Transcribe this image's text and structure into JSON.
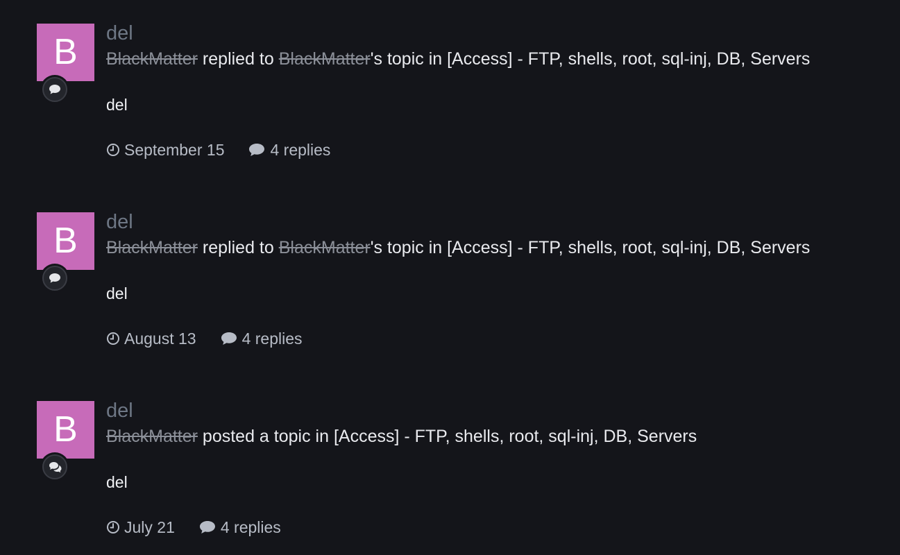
{
  "items": [
    {
      "avatar_letter": "B",
      "author": "del",
      "actor": "BlackMatter",
      "action": " replied to ",
      "topic_owner": "BlackMatter",
      "topic_suffix": "'s topic in ",
      "forum": "[Access] - FTP, shells, root, sql-inj, DB, Servers",
      "snippet": "del",
      "date": "September 15",
      "replies": "4 replies",
      "badge_icon": "comment-icon"
    },
    {
      "avatar_letter": "B",
      "author": "del",
      "actor": "BlackMatter",
      "action": " replied to ",
      "topic_owner": "BlackMatter",
      "topic_suffix": "'s topic in ",
      "forum": "[Access] - FTP, shells, root, sql-inj, DB, Servers",
      "snippet": "del",
      "date": "August 13",
      "replies": "4 replies",
      "badge_icon": "comment-icon"
    },
    {
      "avatar_letter": "B",
      "author": "del",
      "actor": "BlackMatter",
      "action": " posted a topic in ",
      "forum": "[Access] - FTP, shells, root, sql-inj, DB, Servers",
      "snippet": "del",
      "date": "July 21",
      "replies": "4 replies",
      "badge_icon": "comments-icon"
    }
  ],
  "colors": {
    "background": "#14151a",
    "avatar": "#c76bb9",
    "author": "#6e7785",
    "struck_name": "#8b8f98",
    "text": "#e9eaee",
    "meta": "#b7bcc6"
  }
}
